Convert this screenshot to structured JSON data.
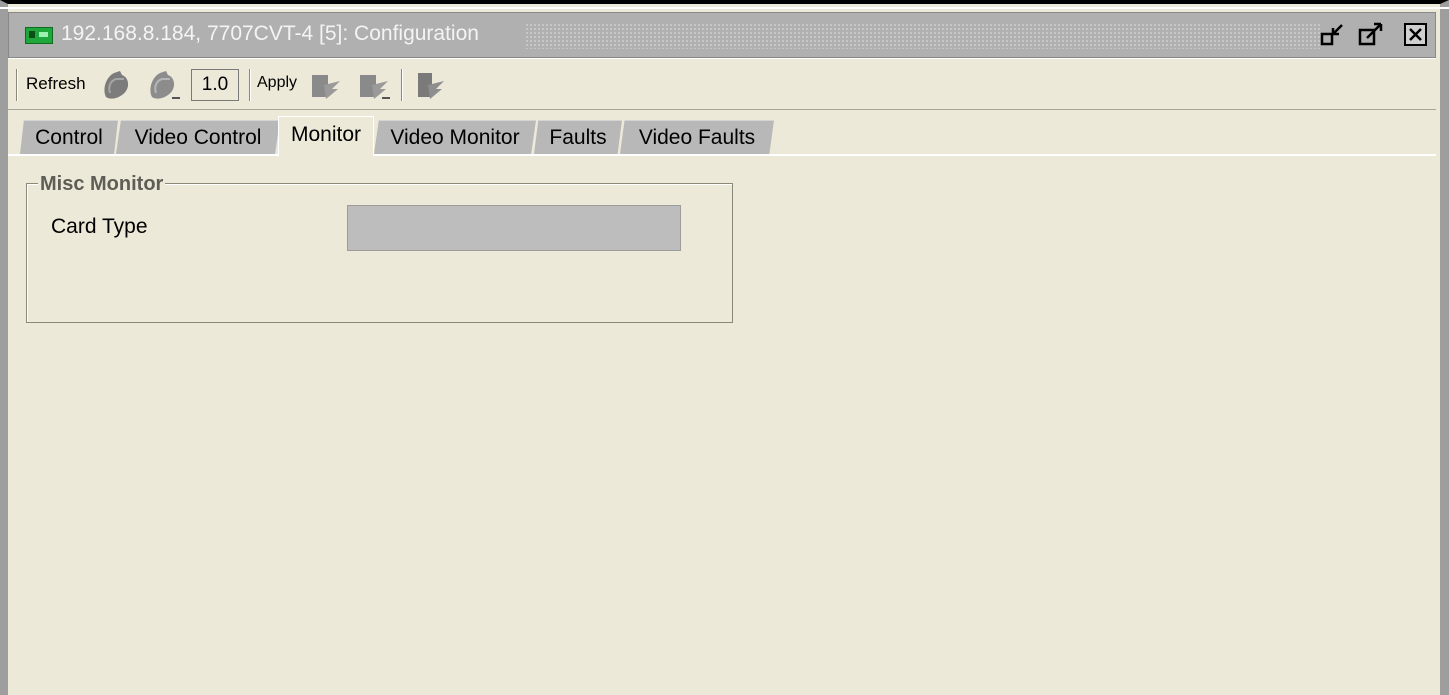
{
  "window": {
    "title": "192.168.8.184, 7707CVT-4  [5]: Configuration",
    "icons": [
      "card-icon",
      "restore-icon",
      "maximize-icon",
      "close-icon"
    ]
  },
  "toolbar": {
    "refresh_label": "Refresh",
    "version_value": "1.0",
    "apply_label": "Apply"
  },
  "tabs": [
    {
      "label": "Control"
    },
    {
      "label": "Video Control"
    },
    {
      "label": "Monitor",
      "active": true
    },
    {
      "label": "Video Monitor"
    },
    {
      "label": "Faults"
    },
    {
      "label": "Video Faults"
    }
  ],
  "panel": {
    "legend": "Misc Monitor",
    "card_type_label": "Card Type",
    "card_type_value": ""
  }
}
